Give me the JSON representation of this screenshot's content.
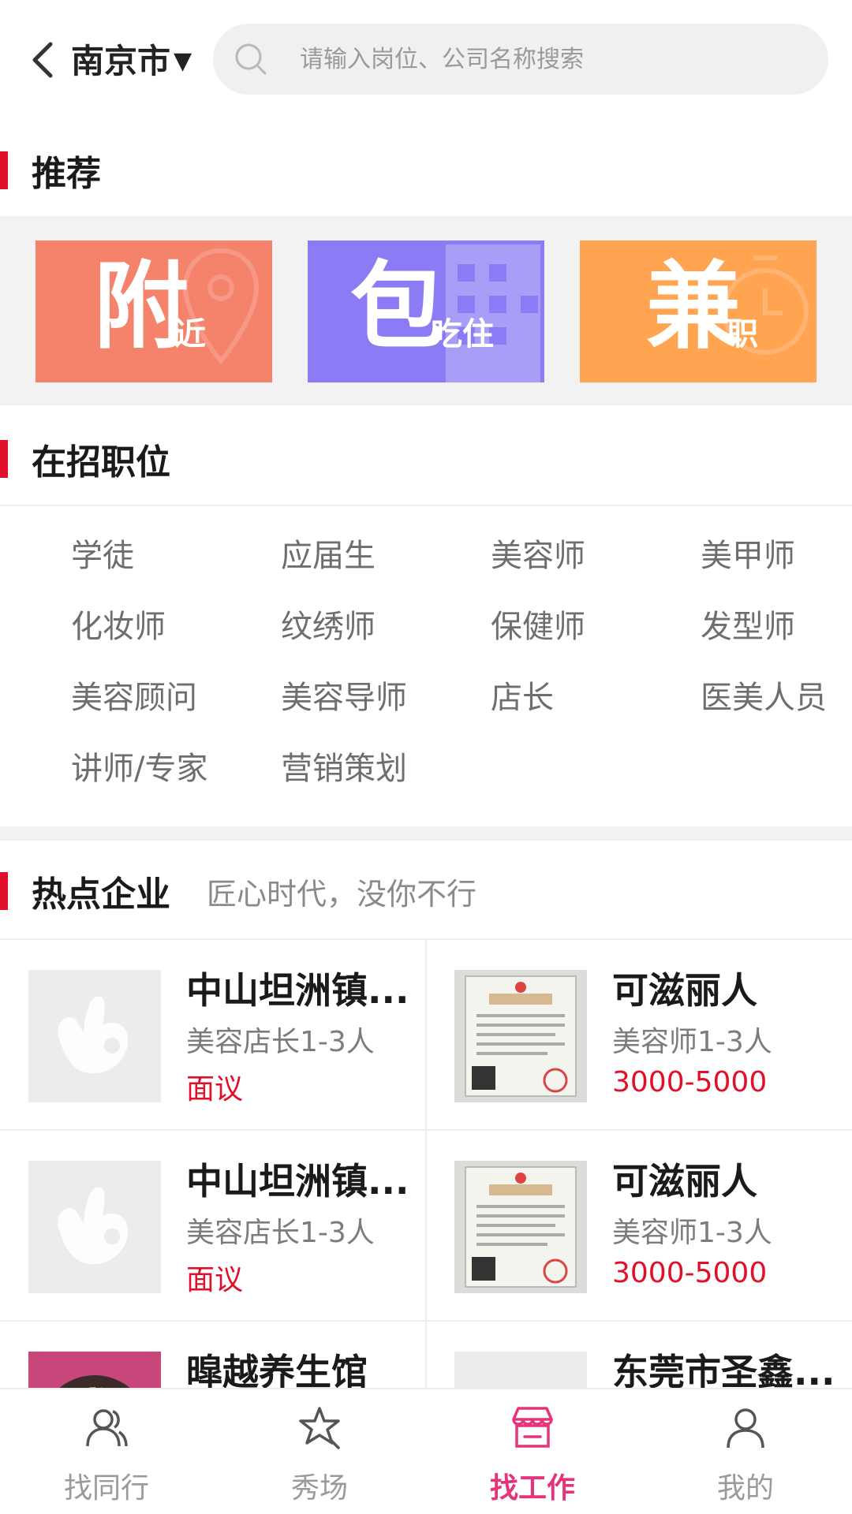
{
  "header": {
    "city": "南京市",
    "search_placeholder": "请输入岗位、公司名称搜索"
  },
  "recommend": {
    "title": "推荐",
    "cards": [
      {
        "big": "附",
        "small": "近",
        "color": "#f5826a",
        "icon": "location-pin-icon"
      },
      {
        "big": "包",
        "small": "吃住",
        "color": "#8b7cf5",
        "icon": "building-icon"
      },
      {
        "big": "兼",
        "small": "职",
        "color": "#ffa552",
        "icon": "clock-icon"
      }
    ]
  },
  "positions": {
    "title": "在招职位",
    "items": [
      "学徒",
      "应届生",
      "美容师",
      "美甲师",
      "化妆师",
      "纹绣师",
      "保健师",
      "发型师",
      "美容顾问",
      "美容导师",
      "店长",
      "医美人员",
      "讲师/专家",
      "营销策划"
    ]
  },
  "companies": {
    "title": "热点企业",
    "subtitle": "匠心时代，没你不行",
    "list": [
      {
        "name": "中山坦洲镇...",
        "role": "美容店长1-3人",
        "salary": "面议",
        "thumb": "placeholder-logo"
      },
      {
        "name": "可滋丽人",
        "role": "美容师1-3人",
        "salary": "3000-5000",
        "thumb": "business-license"
      },
      {
        "name": "中山坦洲镇...",
        "role": "美容店长1-3人",
        "salary": "面议",
        "thumb": "placeholder-logo"
      },
      {
        "name": "可滋丽人",
        "role": "美容师1-3人",
        "salary": "3000-5000",
        "thumb": "business-license"
      },
      {
        "name": "暭越养生馆",
        "role": "",
        "salary": "",
        "thumb": "spa-photo"
      },
      {
        "name": "东莞市圣鑫...",
        "role": "",
        "salary": "",
        "thumb": "placeholder-logo"
      }
    ]
  },
  "tabbar": {
    "tabs": [
      {
        "label": "找同行",
        "icon": "people-icon",
        "active": false
      },
      {
        "label": "秀场",
        "icon": "star-icon",
        "active": false
      },
      {
        "label": "找工作",
        "icon": "shop-icon",
        "active": true
      },
      {
        "label": "我的",
        "icon": "person-icon",
        "active": false
      }
    ],
    "active_color": "#e5337c",
    "accent_red": "#e0102a"
  }
}
